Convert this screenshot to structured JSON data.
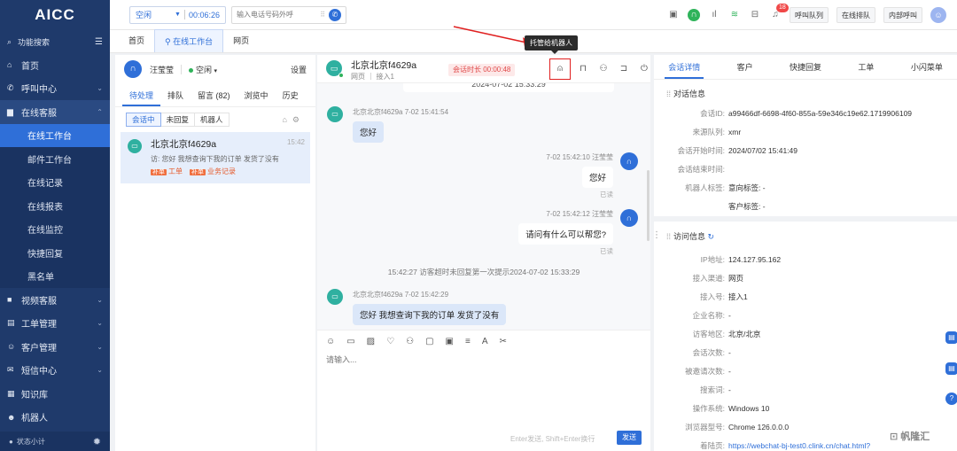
{
  "sidebar": {
    "logo": "AICC",
    "search_label": "功能搜索",
    "nav": [
      {
        "id": "home",
        "label": "首页",
        "icon": "home-icon",
        "glyph": "⌂",
        "chev": ""
      },
      {
        "id": "callcenter",
        "label": "呼叫中心",
        "icon": "phone-icon",
        "glyph": "✆",
        "chev": "⌄"
      },
      {
        "id": "online",
        "label": "在线客服",
        "icon": "chat-icon",
        "glyph": "▆",
        "chev": "⌃"
      }
    ],
    "online_sub": [
      "在线工作台",
      "邮件工作台",
      "在线记录",
      "在线报表",
      "在线监控",
      "快捷回复",
      "黑名单"
    ],
    "nav2": [
      {
        "id": "video",
        "label": "视频客服",
        "icon": "video-icon",
        "glyph": "■",
        "chev": "⌄"
      },
      {
        "id": "ticket",
        "label": "工单管理",
        "icon": "ticket-icon",
        "glyph": "▤",
        "chev": "⌄"
      },
      {
        "id": "customer",
        "label": "客户管理",
        "icon": "customer-icon",
        "glyph": "☺",
        "chev": "⌄"
      },
      {
        "id": "sms",
        "label": "短信中心",
        "icon": "sms-icon",
        "glyph": "✉",
        "chev": "⌄"
      },
      {
        "id": "kb",
        "label": "知识库",
        "icon": "knowledge-icon",
        "glyph": "▦",
        "chev": ""
      },
      {
        "id": "robot",
        "label": "机器人",
        "icon": "robot-icon",
        "glyph": "☻",
        "chev": ""
      }
    ],
    "bottom_label": "状态小计"
  },
  "topbar": {
    "status": "空闲",
    "timer": "00:06:26",
    "dial_placeholder": "输入电话号码外呼",
    "notify_count": "18",
    "buttons": [
      "呼叫队列",
      "在线排队",
      "内部呼叫"
    ]
  },
  "page_tabs": [
    "首页",
    "在线工作台",
    "网页"
  ],
  "list_panel": {
    "agent_name": "汪莹莹",
    "agent_status": "空闲",
    "settings": "设置",
    "tabs": [
      "待处理",
      "排队",
      "留言 (82)",
      "浏览中",
      "历史"
    ],
    "subtabs": [
      "会话中",
      "未回复",
      "机器人"
    ],
    "session": {
      "name": "北京北京f4629a",
      "time": "15:42",
      "preview": "访: 您好 我想查询下我的订单 发货了没有",
      "tag1": "工单",
      "tag2": "业务记录",
      "tag_prefix": "补单"
    }
  },
  "chat": {
    "name": "北京北京f4629a",
    "sub": "网页 ｜ 接入1",
    "duration": "会话时长 00:00:48",
    "tooltip": "托管给机器人",
    "cut_text": "2024-07-02 15:33:29",
    "msg1_meta": "北京北京f4629a  7-02 15:41:54",
    "msg1": "您好",
    "msg2_meta": "7-02 15:42:10 汪莹莹",
    "msg2": "您好",
    "msg3_meta": "7-02 15:42:12 汪莹莹",
    "msg3": "请问有什么可以帮您?",
    "read": "已读",
    "system": "15:42:27 访客超时未回复第一次提示2024-07-02 15:33:29",
    "msg4_meta": "北京北京f4629a  7-02 15:42:29",
    "msg4": "您好 我想查询下我的订单 发货了没有",
    "input_placeholder": "请输入...",
    "send_hint": "Enter发送, Shift+Enter换行",
    "send": "发送"
  },
  "info": {
    "tabs": [
      "会话详情",
      "客户",
      "快捷回复",
      "工单",
      "小闪菜单"
    ],
    "section1": "对话信息",
    "conv": [
      {
        "k": "会话ID:",
        "v": "a99466df-6698-4f60-855a-59e346c19e62.1719906109"
      },
      {
        "k": "来源队列:",
        "v": "xmr"
      },
      {
        "k": "会话开始时间:",
        "v": "2024/07/02 15:41:49"
      },
      {
        "k": "会话结束时间:",
        "v": ""
      },
      {
        "k": "机器人标签:",
        "v": "意向标签: -"
      },
      {
        "k": "",
        "v": "客户标签: -"
      }
    ],
    "section2": "访问信息",
    "visit": [
      {
        "k": "IP地址:",
        "v": "124.127.95.162"
      },
      {
        "k": "接入渠道:",
        "v": "网页"
      },
      {
        "k": "接入号:",
        "v": "接入1"
      },
      {
        "k": "企业名称:",
        "v": "-"
      },
      {
        "k": "访客地区:",
        "v": "北京/北京"
      },
      {
        "k": "会话次数:",
        "v": "-"
      },
      {
        "k": "被邀请次数:",
        "v": "-"
      },
      {
        "k": "搜索词:",
        "v": "-"
      },
      {
        "k": "操作系统:",
        "v": "Windows 10"
      },
      {
        "k": "浏览器型号:",
        "v": "Chrome 126.0.0.0"
      },
      {
        "k": "着陆页:",
        "v": "https://webchat-bj-test0.clink.cn/chat.html?"
      }
    ]
  },
  "watermark": "⊡ 帆隆汇",
  "colors": {
    "primary": "#2f6fd8",
    "sidebar": "#1f3a6b",
    "alert": "#e02020"
  }
}
